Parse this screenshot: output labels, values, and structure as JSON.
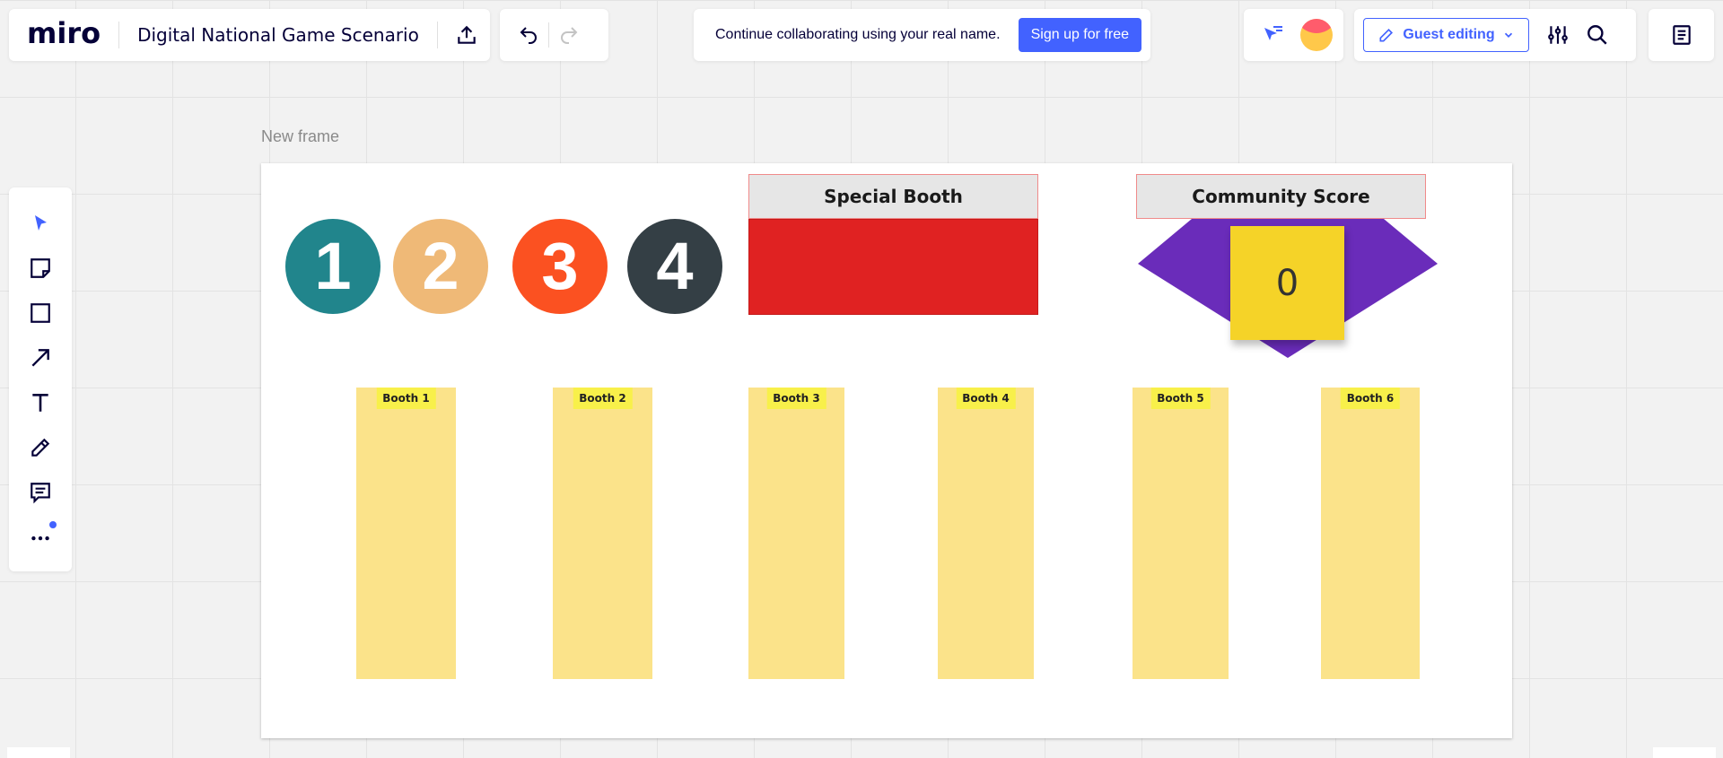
{
  "header": {
    "logo": "miro",
    "board_title": "Digital National Game Scenario",
    "collab_message": "Continue collaborating using your real name.",
    "signup_label": "Sign up for free",
    "guest_editing_label": "Guest editing"
  },
  "colors": {
    "accent": "#4262ff",
    "circle_1": "#21858c",
    "circle_2": "#efb977",
    "circle_3": "#fb5121",
    "circle_4": "#343f45",
    "special_booth": "#e02222",
    "community_diamond": "#6a2cba",
    "score_note": "#f5d328",
    "booth_column": "#fbe38a"
  },
  "canvas": {
    "frame_label": "New frame",
    "circles": [
      "1",
      "2",
      "3",
      "4"
    ],
    "special_booth_title": "Special Booth",
    "community_score_title": "Community Score",
    "community_score_value": "0",
    "booths": [
      "Booth 1",
      "Booth 2",
      "Booth 3",
      "Booth 4",
      "Booth 5",
      "Booth 6"
    ]
  },
  "toolbar": {
    "tools": [
      "select-icon",
      "sticky-note-icon",
      "shape-icon",
      "arrow-icon",
      "text-icon",
      "pen-icon",
      "comment-icon",
      "more-icon"
    ]
  }
}
